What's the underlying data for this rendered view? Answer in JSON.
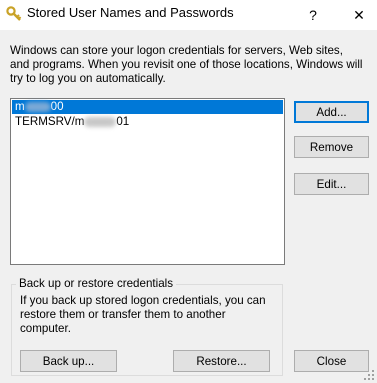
{
  "window": {
    "title": "Stored User Names and Passwords",
    "help_label": "?",
    "close_label": "✕",
    "icon": "key-icon"
  },
  "intro_text": "Windows can store your logon credentials for servers, Web sites, and programs. When you revisit one of those locations, Windows will try to log you on automatically.",
  "credentials": {
    "items": [
      {
        "prefix": "m",
        "suffix": "00",
        "selected": true
      },
      {
        "prefix": "TERMSRV/m",
        "suffix": "01",
        "selected": false
      }
    ]
  },
  "buttons": {
    "add": "Add...",
    "remove": "Remove",
    "edit": "Edit...",
    "backup": "Back up...",
    "restore": "Restore...",
    "close": "Close"
  },
  "backup_group": {
    "title": "Back up or restore credentials",
    "text": "If you back up stored logon credentials, you can restore them or transfer them to another computer."
  },
  "colors": {
    "selection": "#0078d7",
    "button_face": "#e1e1e1",
    "window_bg": "#f0f0f0"
  }
}
